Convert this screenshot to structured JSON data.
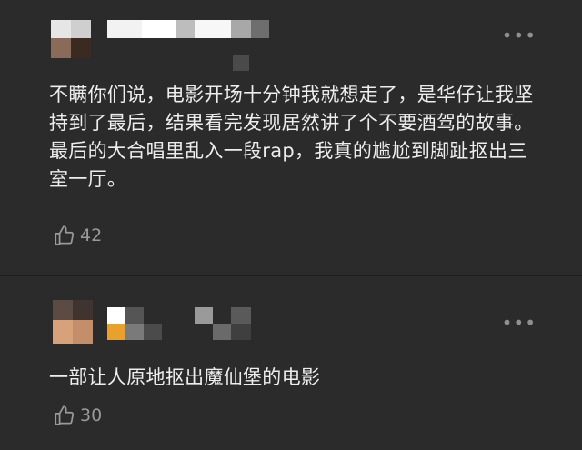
{
  "comments": [
    {
      "text": "不瞒你们说，电影开场十分钟我就想走了，是华仔让我坚持到了最后，结果看完发现居然讲了个不要酒驾的故事。最后的大合唱里乱入一段rap，我真的尴尬到脚趾抠出三室一厅。",
      "likes": "42",
      "more_icon": "more-dots-icon",
      "like_icon": "thumbs-up-icon"
    },
    {
      "text": "一部让人原地抠出魔仙堡的电影",
      "likes": "30",
      "more_icon": "more-dots-icon",
      "like_icon": "thumbs-up-icon"
    }
  ],
  "colors": {
    "background": "#2b2b2b",
    "text": "#ededed",
    "muted": "#9a9a9a"
  }
}
